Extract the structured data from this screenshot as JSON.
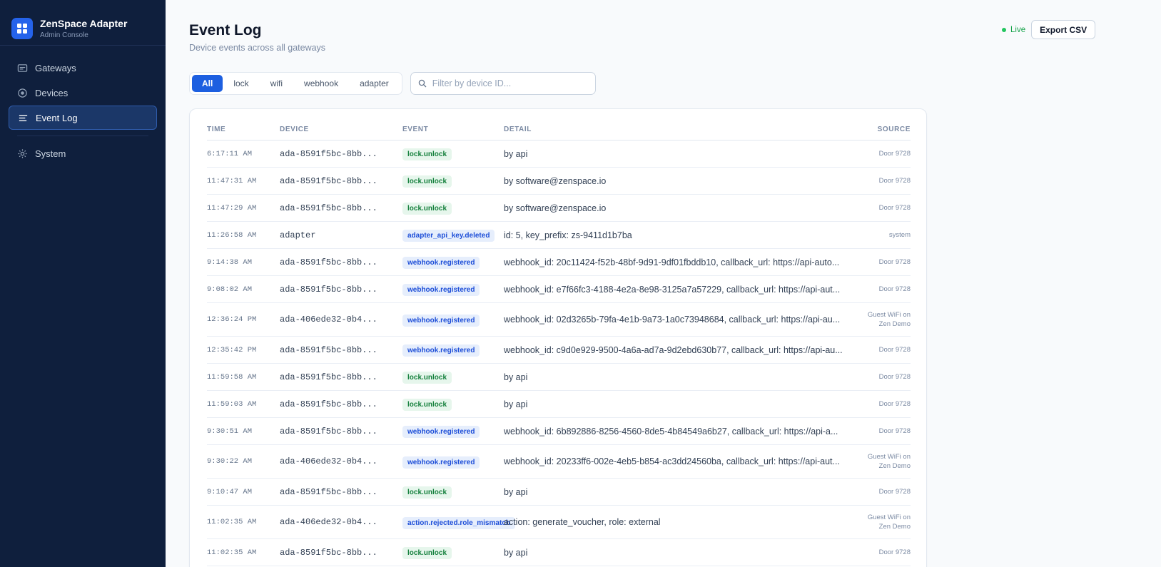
{
  "brand": {
    "title": "ZenSpace Adapter",
    "subtitle": "Admin Console"
  },
  "nav": [
    {
      "label": "Gateways",
      "icon": "gateway-icon",
      "active": false
    },
    {
      "label": "Devices",
      "icon": "device-icon",
      "active": false
    },
    {
      "label": "Event Log",
      "icon": "list-icon",
      "active": true
    },
    {
      "label": "System",
      "icon": "gear-icon",
      "active": false
    }
  ],
  "header": {
    "title": "Event Log",
    "subtitle": "Device events across all gateways",
    "live_label": "Live",
    "export_label": "Export CSV"
  },
  "filters": {
    "tabs": [
      "All",
      "lock",
      "wifi",
      "webhook",
      "adapter"
    ],
    "active_tab": "All",
    "search_placeholder": "Filter by device ID...",
    "search_value": ""
  },
  "colors": {
    "sidebar": "#0f1f3d",
    "accent": "#1d5fe0",
    "live": "#22c55e"
  },
  "table": {
    "columns": [
      "Time",
      "Device",
      "Event",
      "Detail",
      "Source"
    ],
    "rows": [
      {
        "time": "6:17:11 AM",
        "device": "ada-8591f5bc-8bb...",
        "event": "lock.unlock",
        "tone": "green",
        "detail": "by api",
        "source": [
          "Door 9728"
        ]
      },
      {
        "time": "11:47:31 AM",
        "device": "ada-8591f5bc-8bb...",
        "event": "lock.unlock",
        "tone": "green",
        "detail": "by software@zenspace.io",
        "source": [
          "Door 9728"
        ]
      },
      {
        "time": "11:47:29 AM",
        "device": "ada-8591f5bc-8bb...",
        "event": "lock.unlock",
        "tone": "green",
        "detail": "by software@zenspace.io",
        "source": [
          "Door 9728"
        ]
      },
      {
        "time": "11:26:58 AM",
        "device": "adapter",
        "event": "adapter_api_key.deleted",
        "tone": "blue",
        "detail": "id: 5, key_prefix: zs-9411d1b7ba",
        "source": [
          "system"
        ]
      },
      {
        "time": "9:14:38 AM",
        "device": "ada-8591f5bc-8bb...",
        "event": "webhook.registered",
        "tone": "blue",
        "detail": "webhook_id: 20c11424-f52b-48bf-9d91-9df01fbddb10, callback_url: https://api-auto...",
        "source": [
          "Door 9728"
        ]
      },
      {
        "time": "9:08:02 AM",
        "device": "ada-8591f5bc-8bb...",
        "event": "webhook.registered",
        "tone": "blue",
        "detail": "webhook_id: e7f66fc3-4188-4e2a-8e98-3125a7a57229, callback_url: https://api-aut...",
        "source": [
          "Door 9728"
        ]
      },
      {
        "time": "12:36:24 PM",
        "device": "ada-406ede32-0b4...",
        "event": "webhook.registered",
        "tone": "blue",
        "detail": "webhook_id: 02d3265b-79fa-4e1b-9a73-1a0c73948684, callback_url: https://api-au...",
        "source": [
          "Guest WiFi on",
          "Zen Demo"
        ]
      },
      {
        "time": "12:35:42 PM",
        "device": "ada-8591f5bc-8bb...",
        "event": "webhook.registered",
        "tone": "blue",
        "detail": "webhook_id: c9d0e929-9500-4a6a-ad7a-9d2ebd630b77, callback_url: https://api-au...",
        "source": [
          "Door 9728"
        ]
      },
      {
        "time": "11:59:58 AM",
        "device": "ada-8591f5bc-8bb...",
        "event": "lock.unlock",
        "tone": "green",
        "detail": "by api",
        "source": [
          "Door 9728"
        ]
      },
      {
        "time": "11:59:03 AM",
        "device": "ada-8591f5bc-8bb...",
        "event": "lock.unlock",
        "tone": "green",
        "detail": "by api",
        "source": [
          "Door 9728"
        ]
      },
      {
        "time": "9:30:51 AM",
        "device": "ada-8591f5bc-8bb...",
        "event": "webhook.registered",
        "tone": "blue",
        "detail": "webhook_id: 6b892886-8256-4560-8de5-4b84549a6b27, callback_url: https://api-a...",
        "source": [
          "Door 9728"
        ]
      },
      {
        "time": "9:30:22 AM",
        "device": "ada-406ede32-0b4...",
        "event": "webhook.registered",
        "tone": "blue",
        "detail": "webhook_id: 20233ff6-002e-4eb5-b854-ac3dd24560ba, callback_url: https://api-aut...",
        "source": [
          "Guest WiFi on",
          "Zen Demo"
        ]
      },
      {
        "time": "9:10:47 AM",
        "device": "ada-8591f5bc-8bb...",
        "event": "lock.unlock",
        "tone": "green",
        "detail": "by api",
        "source": [
          "Door 9728"
        ]
      },
      {
        "time": "11:02:35 AM",
        "device": "ada-406ede32-0b4...",
        "event": "action.rejected.role_mismatch",
        "tone": "blue",
        "detail": "action: generate_voucher, role: external",
        "source": [
          "Guest WiFi on",
          "Zen Demo"
        ]
      },
      {
        "time": "11:02:35 AM",
        "device": "ada-8591f5bc-8bb...",
        "event": "lock.unlock",
        "tone": "green",
        "detail": "by api",
        "source": [
          "Door 9728"
        ]
      },
      {
        "time": "",
        "device": "",
        "event": "",
        "tone": "green",
        "detail": "",
        "source": [
          ""
        ]
      }
    ]
  }
}
